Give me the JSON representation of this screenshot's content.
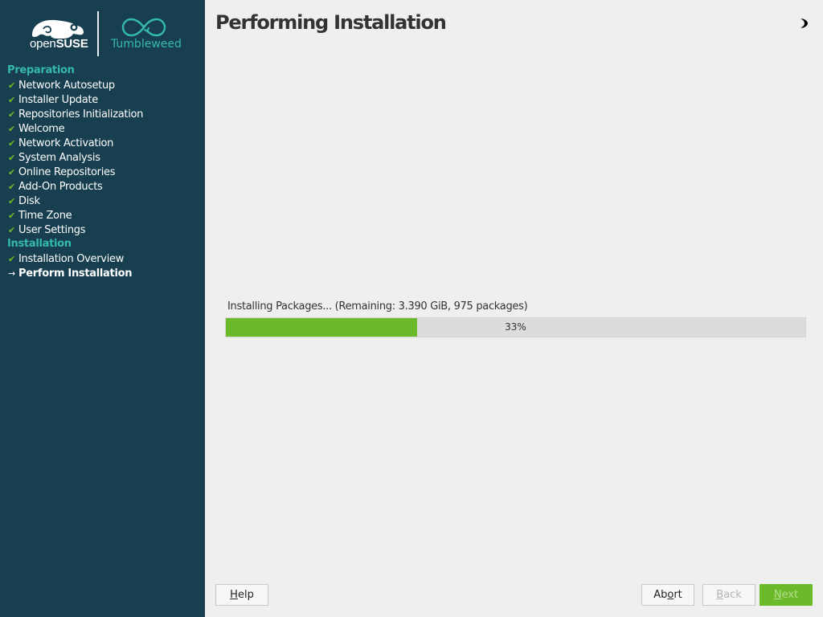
{
  "brand": {
    "opensuse_light": "open",
    "opensuse_bold": "SUSE",
    "product": "Tumbleweed"
  },
  "sidebar": {
    "sections": [
      {
        "heading": "Preparation",
        "steps": [
          {
            "label": "Network Autosetup",
            "status": "done"
          },
          {
            "label": "Installer Update",
            "status": "done"
          },
          {
            "label": "Repositories Initialization",
            "status": "done"
          },
          {
            "label": "Welcome",
            "status": "done"
          },
          {
            "label": "Network Activation",
            "status": "done"
          },
          {
            "label": "System Analysis",
            "status": "done"
          },
          {
            "label": "Online Repositories",
            "status": "done"
          },
          {
            "label": "Add-On Products",
            "status": "done"
          },
          {
            "label": "Disk",
            "status": "done"
          },
          {
            "label": "Time Zone",
            "status": "done"
          },
          {
            "label": "User Settings",
            "status": "done"
          }
        ]
      },
      {
        "heading": "Installation",
        "steps": [
          {
            "label": "Installation Overview",
            "status": "done"
          },
          {
            "label": "Perform Installation",
            "status": "current"
          }
        ]
      }
    ],
    "done_mark": "✔",
    "current_mark": "→"
  },
  "main": {
    "title": "Performing Installation",
    "progress": {
      "label": "Installing Packages... (Remaining: 3.390 GiB, 975 packages)",
      "percent": 33,
      "text": "33%"
    }
  },
  "buttons": {
    "help": {
      "pre": "",
      "accel": "H",
      "post": "elp"
    },
    "abort": {
      "pre": "Ab",
      "accel": "o",
      "post": "rt"
    },
    "back": {
      "pre": "",
      "accel": "B",
      "post": "ack",
      "enabled": false
    },
    "next": {
      "pre": "",
      "accel": "N",
      "post": "ext",
      "enabled": false
    }
  },
  "colors": {
    "sidebar_bg": "#173f4f",
    "accent_teal": "#35b9ab",
    "accent_green": "#6aba2a",
    "background": "#efefef"
  },
  "icons": {
    "logo": "opensuse-chameleon-icon",
    "product": "tumbleweed-infinity-icon",
    "theme": "half-moon-icon"
  }
}
